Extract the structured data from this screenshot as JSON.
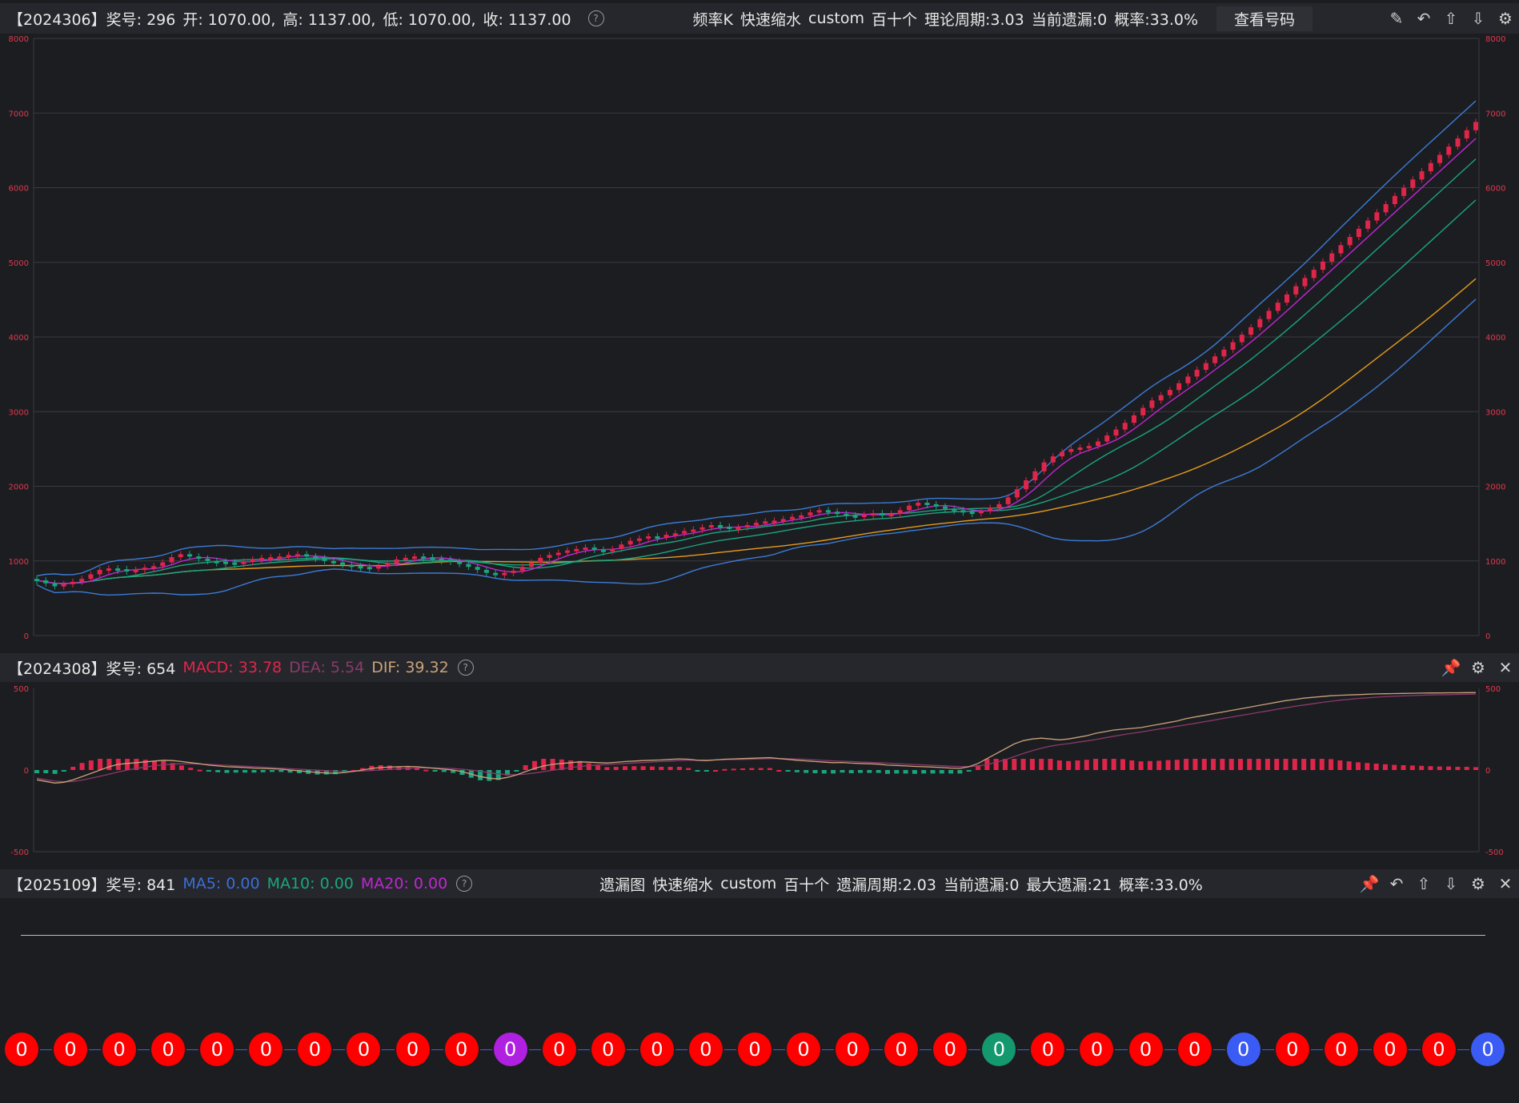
{
  "header": {
    "period": "【2024306】",
    "award": "奖号: 296",
    "open": "开: 1070.00,",
    "high": "高: 1137.00,",
    "low": "低: 1070.00,",
    "close": "收: 1137.00",
    "mode": "频率K",
    "speed": "快速缩水",
    "custom": "custom",
    "position": "百十个",
    "cycle": "理论周期:3.03",
    "current_miss": "当前遗漏:0",
    "prob": "概率:33.0%",
    "view_button": "查看号码",
    "icons": [
      "edit-icon",
      "undo-icon",
      "up-icon",
      "down-icon",
      "settings-icon"
    ]
  },
  "macd_header": {
    "period": "【2024308】",
    "award": "奖号: 654",
    "macd": "MACD: 33.78",
    "dea": "DEA: 5.54",
    "dif": "DIF: 39.32",
    "icons": [
      "pin-icon",
      "settings-icon",
      "close-icon"
    ]
  },
  "miss_header": {
    "period": "【2025109】",
    "award": "奖号: 841",
    "ma5": "MA5: 0.00",
    "ma10": "MA10: 0.00",
    "ma20": "MA20: 0.00",
    "mode": "遗漏图",
    "speed": "快速缩水",
    "custom": "custom",
    "position": "百十个",
    "cycle": "遗漏周期:2.03",
    "current_miss": "当前遗漏:0",
    "max_miss": "最大遗漏:21",
    "prob": "概率:33.0%",
    "icons": [
      "pin-icon",
      "undo-icon",
      "up-icon",
      "down-icon",
      "settings-icon",
      "close-icon"
    ]
  },
  "colors": {
    "up": "#e0254b",
    "down": "#1aa57f",
    "ma_purple": "#c026d3",
    "ma_green": "#1aa57f",
    "ma_blue": "#3a6fd6",
    "ma_orange": "#e39b1c",
    "boll": "#3c7bd6",
    "axis_label": "#e0394e",
    "ball_red": "#ff0000",
    "ball_purple": "#b020e0",
    "ball_green": "#14986d",
    "ball_blue": "#3b5bf5"
  },
  "chart_data": [
    {
      "type": "candlestick",
      "y_ticks": [
        "0",
        "1000",
        "2000",
        "3000",
        "4000",
        "5000",
        "6000",
        "7000",
        "8000"
      ],
      "ylim": [
        0,
        8000
      ],
      "close_series": [
        740,
        700,
        660,
        690,
        720,
        760,
        820,
        880,
        900,
        890,
        870,
        880,
        910,
        930,
        980,
        1050,
        1090,
        1060,
        1030,
        1000,
        990,
        980,
        970,
        990,
        1020,
        1040,
        1050,
        1060,
        1080,
        1090,
        1060,
        1040,
        1000,
        980,
        950,
        930,
        920,
        900,
        930,
        970,
        1020,
        1040,
        1060,
        1050,
        1030,
        1020,
        990,
        960,
        920,
        880,
        840,
        820,
        840,
        870,
        920,
        980,
        1040,
        1080,
        1110,
        1140,
        1160,
        1180,
        1150,
        1130,
        1160,
        1220,
        1270,
        1300,
        1330,
        1320,
        1350,
        1370,
        1400,
        1420,
        1450,
        1480,
        1460,
        1430,
        1450,
        1480,
        1510,
        1530,
        1540,
        1560,
        1590,
        1610,
        1650,
        1680,
        1660,
        1630,
        1610,
        1600,
        1620,
        1640,
        1610,
        1630,
        1680,
        1740,
        1780,
        1760,
        1730,
        1700,
        1680,
        1660,
        1640,
        1670,
        1710,
        1760,
        1850,
        1960,
        2080,
        2200,
        2320,
        2400,
        2460,
        2500,
        2520,
        2540,
        2600,
        2680,
        2760,
        2850,
        2950,
        3050,
        3150,
        3220,
        3290,
        3380,
        3470,
        3560,
        3650,
        3740,
        3830,
        3930,
        4030,
        4130,
        4240,
        4350,
        4460,
        4570,
        4680,
        4790,
        4900,
        5010,
        5120,
        5230,
        5340,
        5450,
        5560,
        5670,
        5780,
        5890,
        6000,
        6110,
        6220,
        6330,
        6440,
        6550,
        6660,
        6770,
        6880
      ]
    },
    {
      "type": "line",
      "name": "MACD",
      "y_ticks": [
        "-500",
        "0",
        "500"
      ],
      "ylim": [
        -500,
        500
      ],
      "dif": [
        -60,
        -70,
        -80,
        -75,
        -60,
        -40,
        -20,
        0,
        20,
        35,
        40,
        45,
        50,
        55,
        60,
        58,
        52,
        45,
        38,
        30,
        25,
        20,
        18,
        15,
        12,
        10,
        8,
        5,
        0,
        -5,
        -10,
        -15,
        -18,
        -20,
        -15,
        -8,
        0,
        10,
        15,
        18,
        20,
        22,
        20,
        15,
        10,
        5,
        0,
        -10,
        -25,
        -40,
        -50,
        -55,
        -45,
        -30,
        -10,
        10,
        25,
        35,
        40,
        45,
        50,
        48,
        45,
        43,
        47,
        52,
        55,
        58,
        60,
        62,
        65,
        68,
        66,
        60,
        58,
        62,
        66,
        68,
        70,
        72,
        74,
        76,
        70,
        65,
        60,
        56,
        52,
        48,
        45,
        46,
        42,
        40,
        38,
        36,
        30,
        28,
        25,
        22,
        20,
        18,
        15,
        12,
        10,
        20,
        40,
        70,
        100,
        130,
        160,
        180,
        190,
        195,
        190,
        185,
        190,
        200,
        210,
        225,
        235,
        245,
        250,
        255,
        260,
        270,
        280,
        290,
        300,
        315,
        325,
        335,
        345,
        355,
        365,
        375,
        385,
        395,
        405,
        415,
        425,
        432,
        440,
        445,
        450,
        455,
        458,
        460,
        462,
        464,
        466,
        467,
        468,
        469,
        470,
        471,
        472,
        472,
        473,
        473,
        474,
        474
      ],
      "dea": [
        -50,
        -60,
        -68,
        -72,
        -70,
        -62,
        -50,
        -38,
        -25,
        -12,
        0,
        10,
        18,
        26,
        32,
        36,
        38,
        38,
        37,
        35,
        32,
        29,
        26,
        23,
        20,
        17,
        14,
        11,
        8,
        5,
        2,
        -1,
        -4,
        -7,
        -8,
        -8,
        -6,
        -3,
        0,
        4,
        8,
        11,
        13,
        14,
        13,
        11,
        9,
        5,
        -1,
        -8,
        -16,
        -24,
        -28,
        -29,
        -25,
        -18,
        -10,
        -1,
        7,
        15,
        22,
        27,
        31,
        34,
        37,
        40,
        43,
        46,
        49,
        52,
        55,
        58,
        60,
        61,
        61,
        62,
        63,
        64,
        65,
        66,
        68,
        70,
        70,
        69,
        67,
        65,
        62,
        59,
        56,
        54,
        52,
        49,
        47,
        45,
        42,
        39,
        36,
        34,
        31,
        29,
        26,
        23,
        21,
        21,
        25,
        34,
        47,
        63,
        82,
        101,
        119,
        134,
        146,
        155,
        162,
        170,
        178,
        187,
        197,
        207,
        216,
        225,
        233,
        242,
        251,
        259,
        268,
        277,
        286,
        296,
        305,
        315,
        324,
        334,
        343,
        353,
        362,
        372,
        381,
        390,
        398,
        406,
        414,
        421,
        428,
        433,
        438,
        442,
        446,
        449,
        452,
        454,
        456,
        458,
        460,
        461,
        462,
        463,
        464,
        465
      ]
    }
  ],
  "balls": [
    {
      "v": "0",
      "c": "red"
    },
    {
      "v": "0",
      "c": "red"
    },
    {
      "v": "0",
      "c": "red"
    },
    {
      "v": "0",
      "c": "red"
    },
    {
      "v": "0",
      "c": "red"
    },
    {
      "v": "0",
      "c": "red"
    },
    {
      "v": "0",
      "c": "red"
    },
    {
      "v": "0",
      "c": "red"
    },
    {
      "v": "0",
      "c": "red"
    },
    {
      "v": "0",
      "c": "red"
    },
    {
      "v": "0",
      "c": "purple"
    },
    {
      "v": "0",
      "c": "red"
    },
    {
      "v": "0",
      "c": "red"
    },
    {
      "v": "0",
      "c": "red"
    },
    {
      "v": "0",
      "c": "red"
    },
    {
      "v": "0",
      "c": "red"
    },
    {
      "v": "0",
      "c": "red"
    },
    {
      "v": "0",
      "c": "red"
    },
    {
      "v": "0",
      "c": "red"
    },
    {
      "v": "0",
      "c": "red"
    },
    {
      "v": "0",
      "c": "green"
    },
    {
      "v": "0",
      "c": "red"
    },
    {
      "v": "0",
      "c": "red"
    },
    {
      "v": "0",
      "c": "red"
    },
    {
      "v": "0",
      "c": "red"
    },
    {
      "v": "0",
      "c": "blue"
    },
    {
      "v": "0",
      "c": "red"
    },
    {
      "v": "0",
      "c": "red"
    },
    {
      "v": "0",
      "c": "red"
    },
    {
      "v": "0",
      "c": "red"
    },
    {
      "v": "0",
      "c": "blue"
    }
  ]
}
